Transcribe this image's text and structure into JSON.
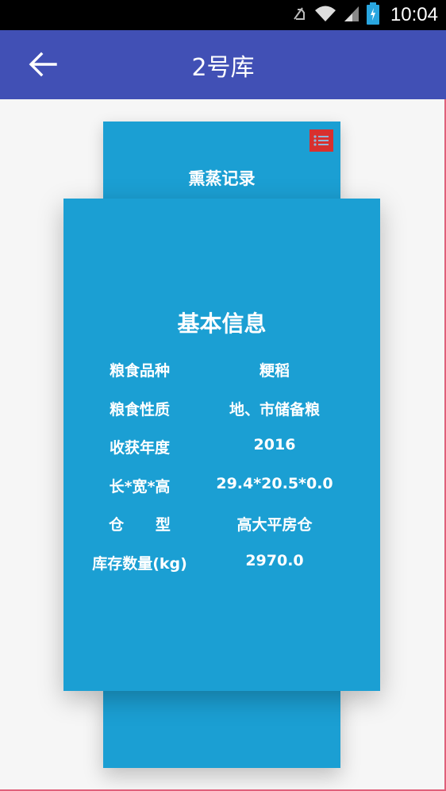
{
  "status_bar": {
    "time": "10:04"
  },
  "app_bar": {
    "title": "2号库"
  },
  "card_back": {
    "title": "熏蒸记录"
  },
  "basic_info": {
    "title": "基本信息",
    "rows": [
      {
        "label": "粮食品种",
        "value": "粳稻"
      },
      {
        "label": "粮食性质",
        "value": "地、市储备粮"
      },
      {
        "label": "收获年度",
        "value": "2016"
      },
      {
        "label": "长*宽*高",
        "value": "29.4*20.5*0.0"
      },
      {
        "label": "仓      型",
        "value": "高大平房仓"
      },
      {
        "label": "库存数量(kg)",
        "value": "2970.0"
      }
    ]
  },
  "colors": {
    "app_bar": "#4150b5",
    "card": "#1b9fd3",
    "menu_button": "#d8302e"
  }
}
